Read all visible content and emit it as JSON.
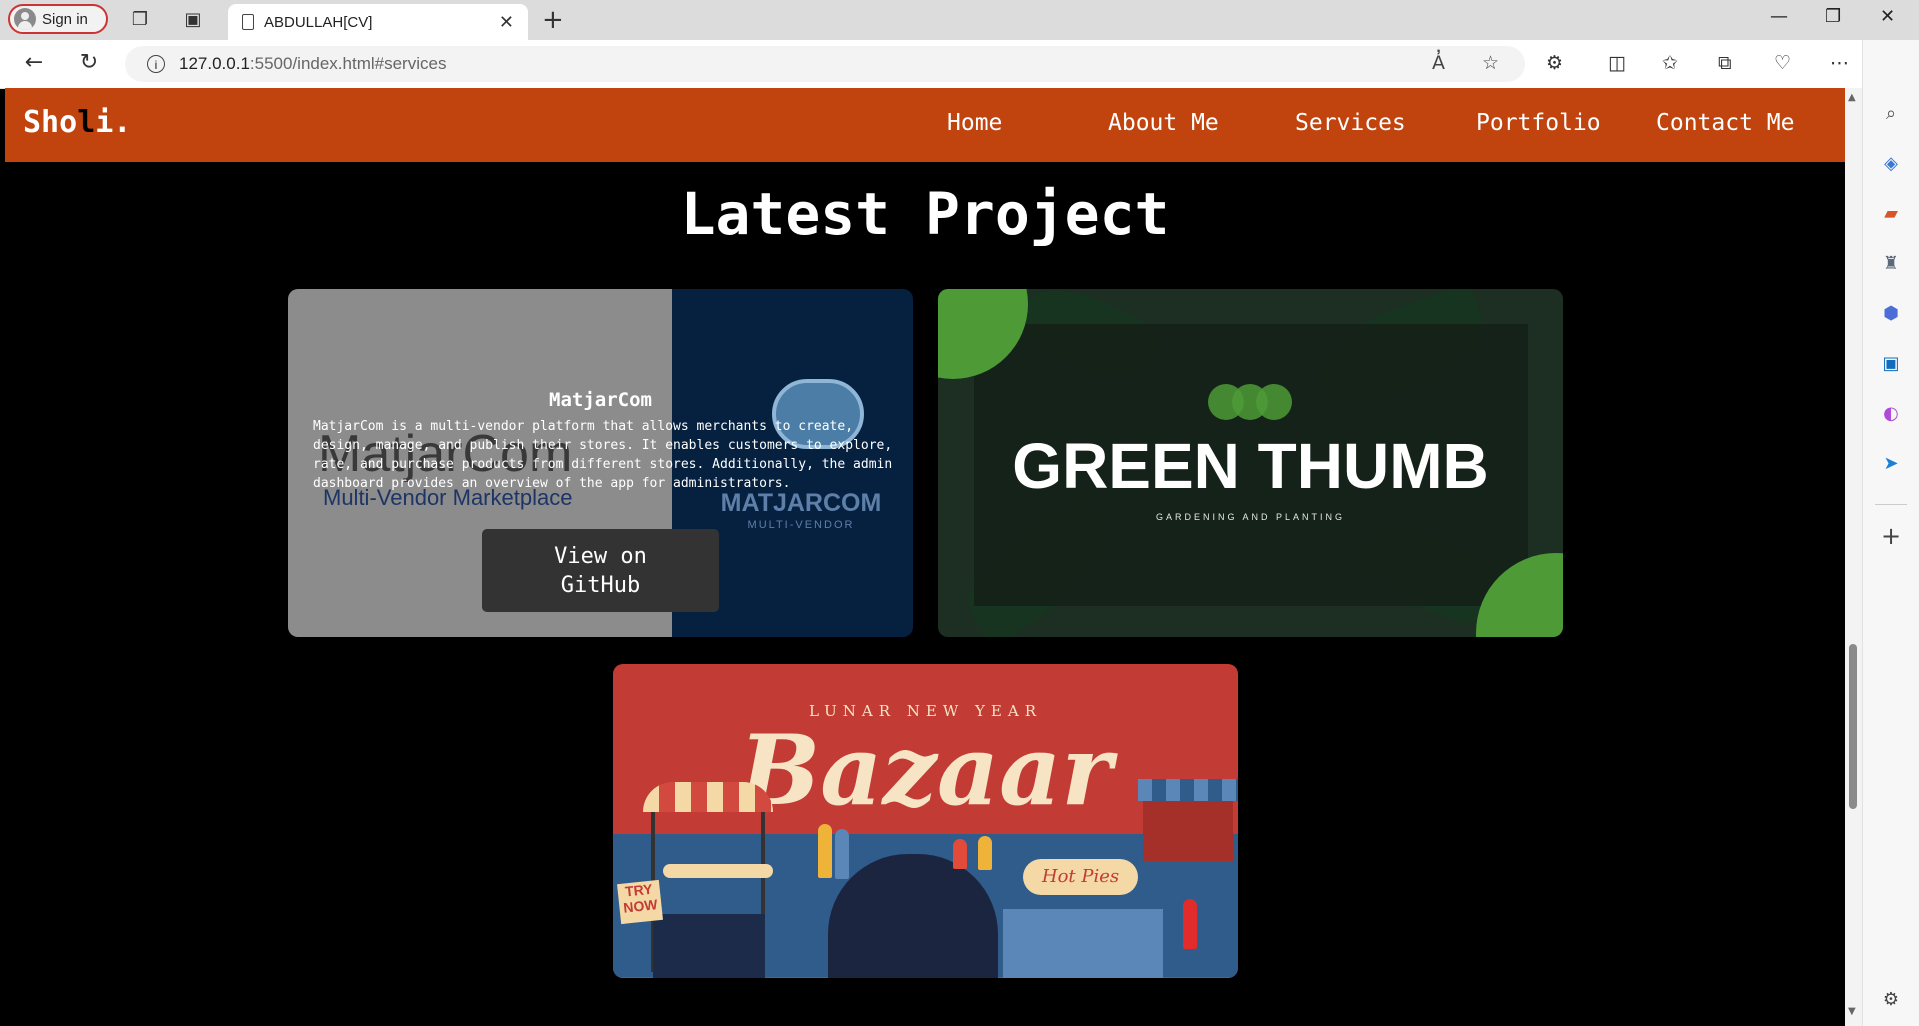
{
  "browser": {
    "sign_in_label": "Sign in",
    "tab_title": "ABDULLAH[CV]",
    "url_host": "127.0.0.1",
    "url_path": ":5500/index.html#services"
  },
  "site": {
    "logo_prefix": "Sho",
    "logo_letter": "l",
    "logo_suffix": "i.",
    "nav": [
      "Home",
      "About Me",
      "Services",
      "Portfolio",
      "Contact Me"
    ],
    "section_title": "Latest Project"
  },
  "projects": [
    {
      "title": "MatjarCom",
      "description": "MatjarCom is a multi-vendor platform that allows merchants to create, design, manage, and publish their stores. It enables customers to explore, rate, and purchase products from different stores. Additionally, the admin dashboard provides an overview of the app for administrators.",
      "button_label": "View on GitHub",
      "image_brand": "MATJARCOM",
      "image_brand_sub": "MULTI-VENDOR",
      "image_ghost_title": "MatjarCom",
      "image_ghost_sub": "Multi-Vendor Marketplace"
    },
    {
      "title": "GREEN THUMB",
      "subtitle": "GARDENING AND PLANTING",
      "accent": "#4e9a37"
    },
    {
      "lunar": "LUNAR NEW YEAR",
      "title": "Bazaar",
      "try_now": "TRY NOW",
      "hot_pies": "Hot Pies"
    }
  ],
  "colors": {
    "nav_bg": "#c1440e",
    "page_bg": "#000000",
    "button_bg": "#333333"
  }
}
